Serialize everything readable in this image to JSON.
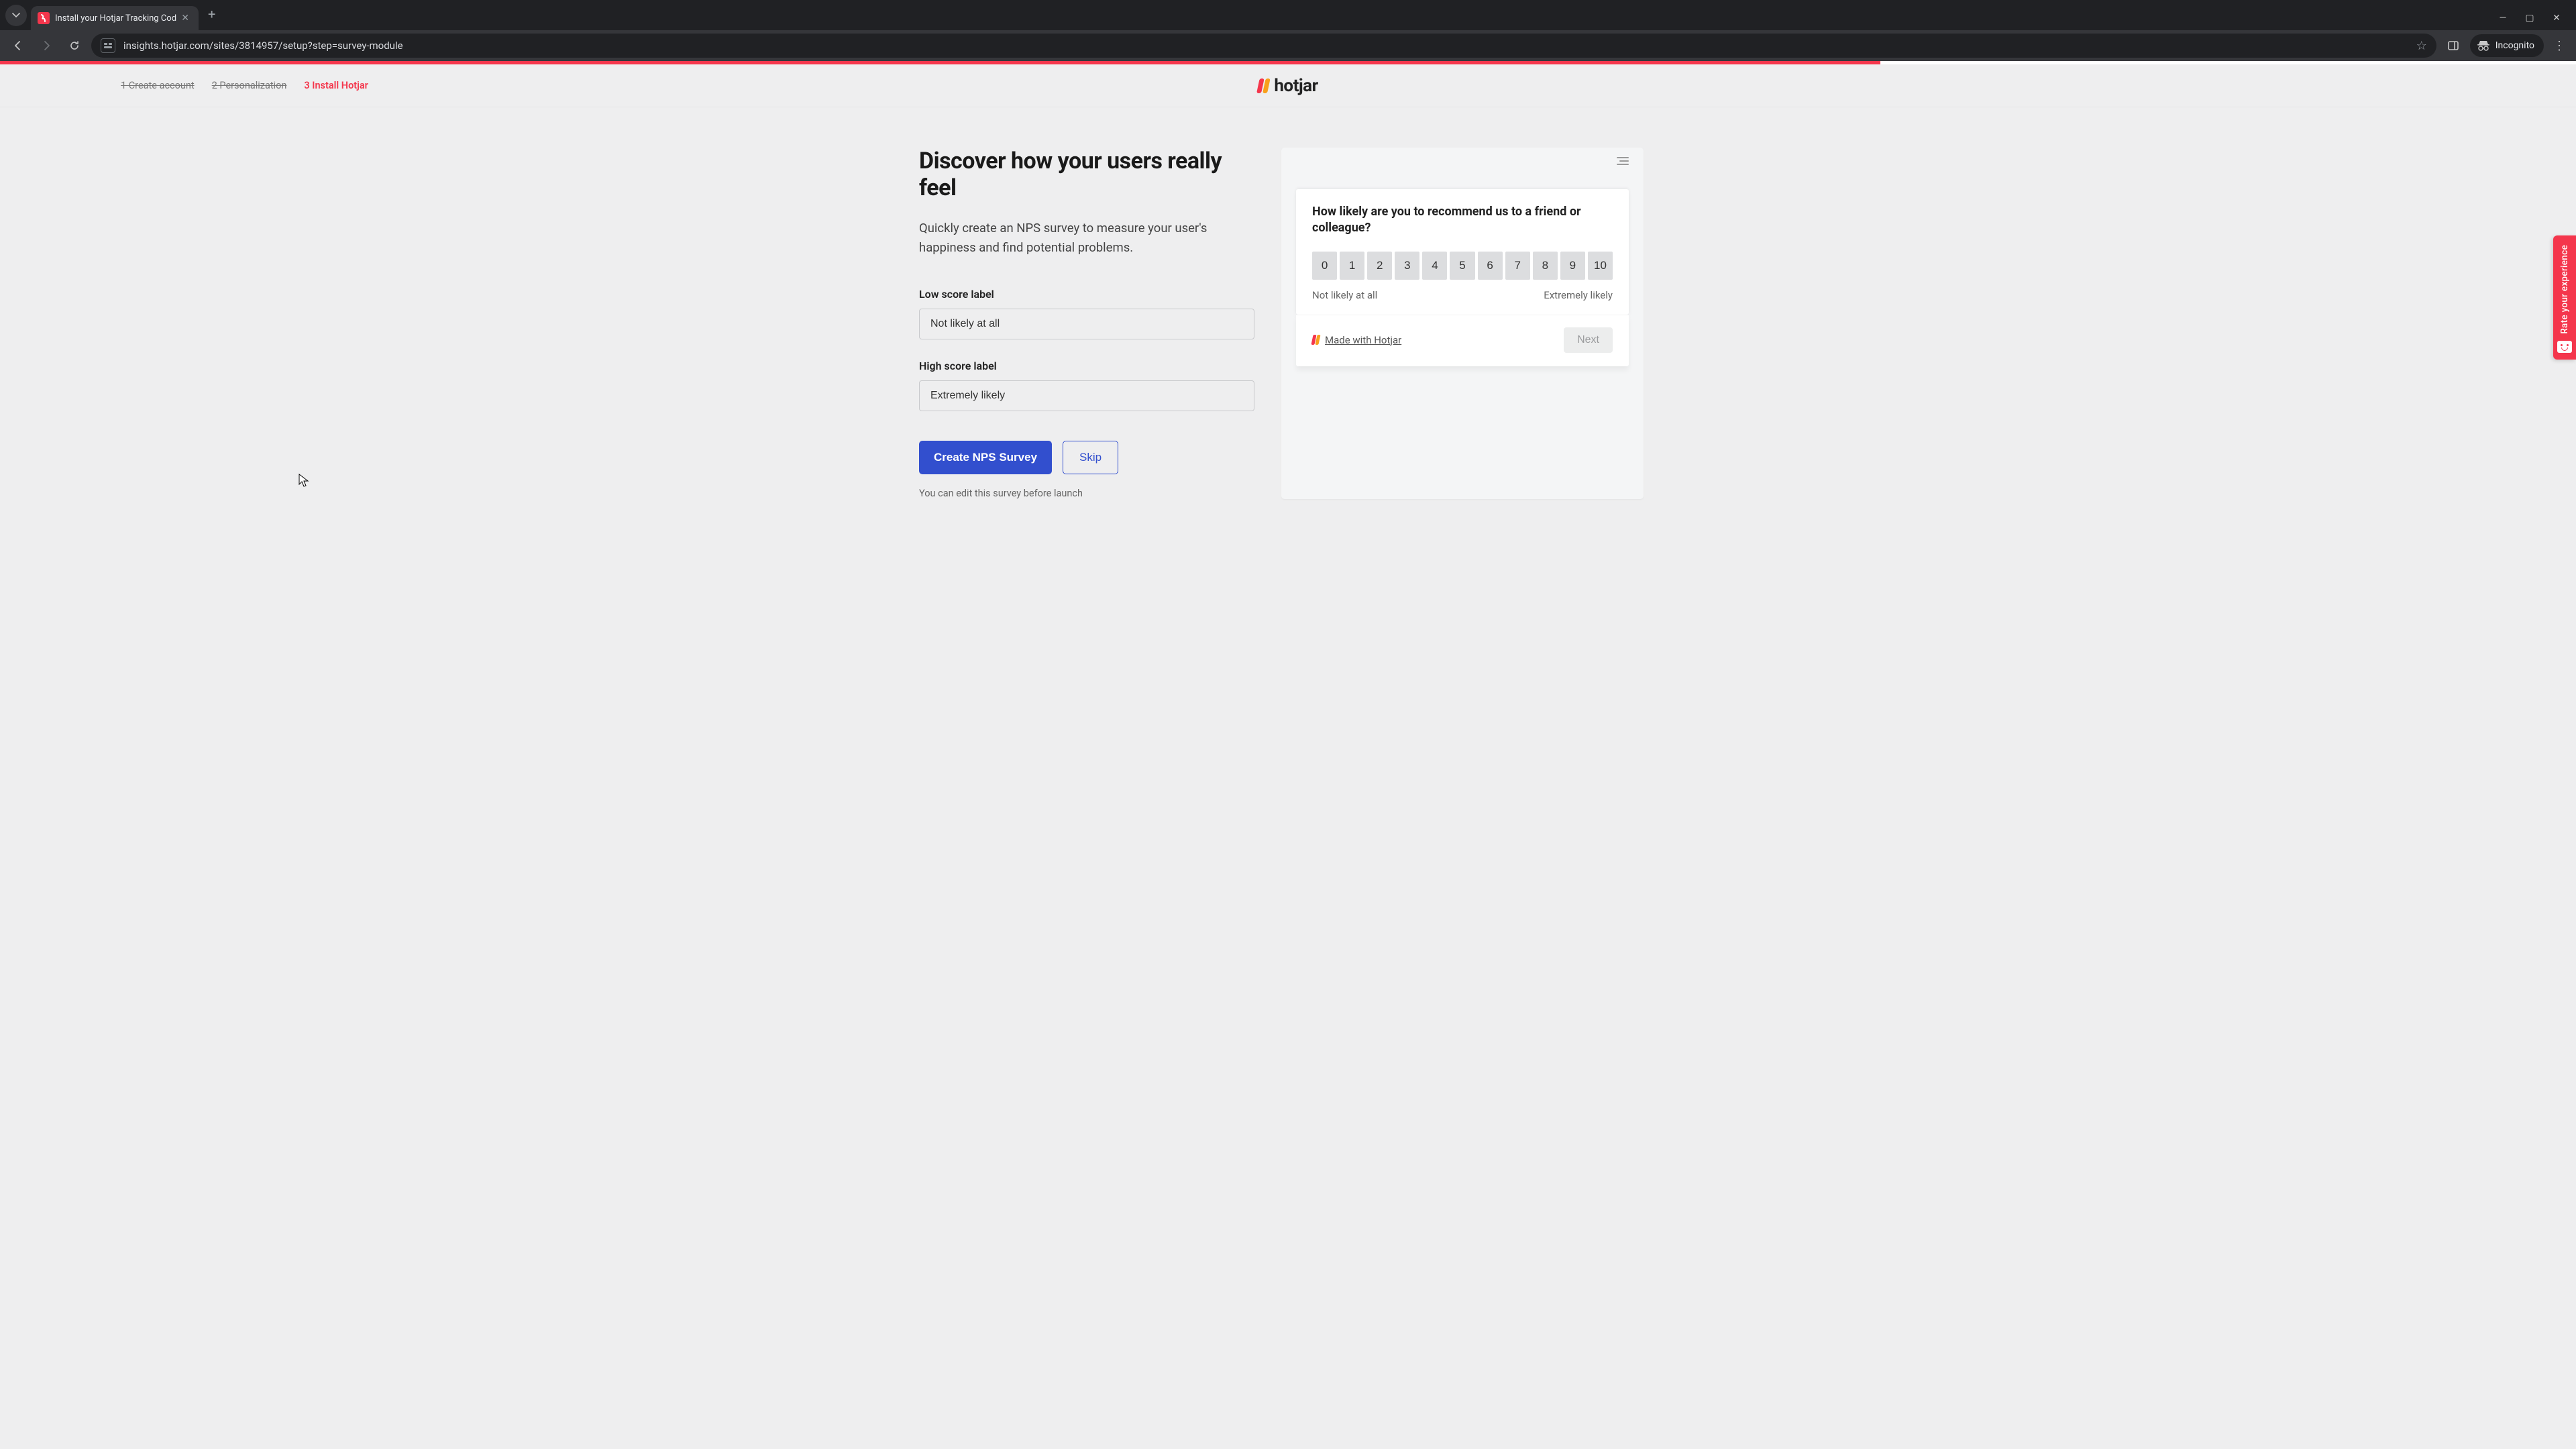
{
  "browser": {
    "tab_title": "Install your Hotjar Tracking Cod",
    "url": "insights.hotjar.com/sites/3814957/setup?step=survey-module",
    "incognito_label": "Incognito"
  },
  "steps": {
    "s1": "1 Create account",
    "s2": "2 Personalization",
    "s3": "3 Install Hotjar"
  },
  "logo_text": "hotjar",
  "page": {
    "title": "Discover how your users really feel",
    "subtitle": "Quickly create an NPS survey to measure your user's happiness and find potential problems.",
    "low_label_caption": "Low score label",
    "low_label_value": "Not likely at all",
    "high_label_caption": "High score label",
    "high_label_value": "Extremely likely",
    "create_btn": "Create NPS Survey",
    "skip_btn": "Skip",
    "edit_note": "You can edit this survey before launch"
  },
  "survey": {
    "question": "How likely are you to recommend us to a friend or colleague?",
    "scores": [
      "0",
      "1",
      "2",
      "3",
      "4",
      "5",
      "6",
      "7",
      "8",
      "9",
      "10"
    ],
    "low_text": "Not likely at all",
    "high_text": "Extremely likely",
    "made_with": "Made with Hotjar",
    "next": "Next"
  },
  "feedback_tab": "Rate your experience",
  "progress_percent": 73
}
